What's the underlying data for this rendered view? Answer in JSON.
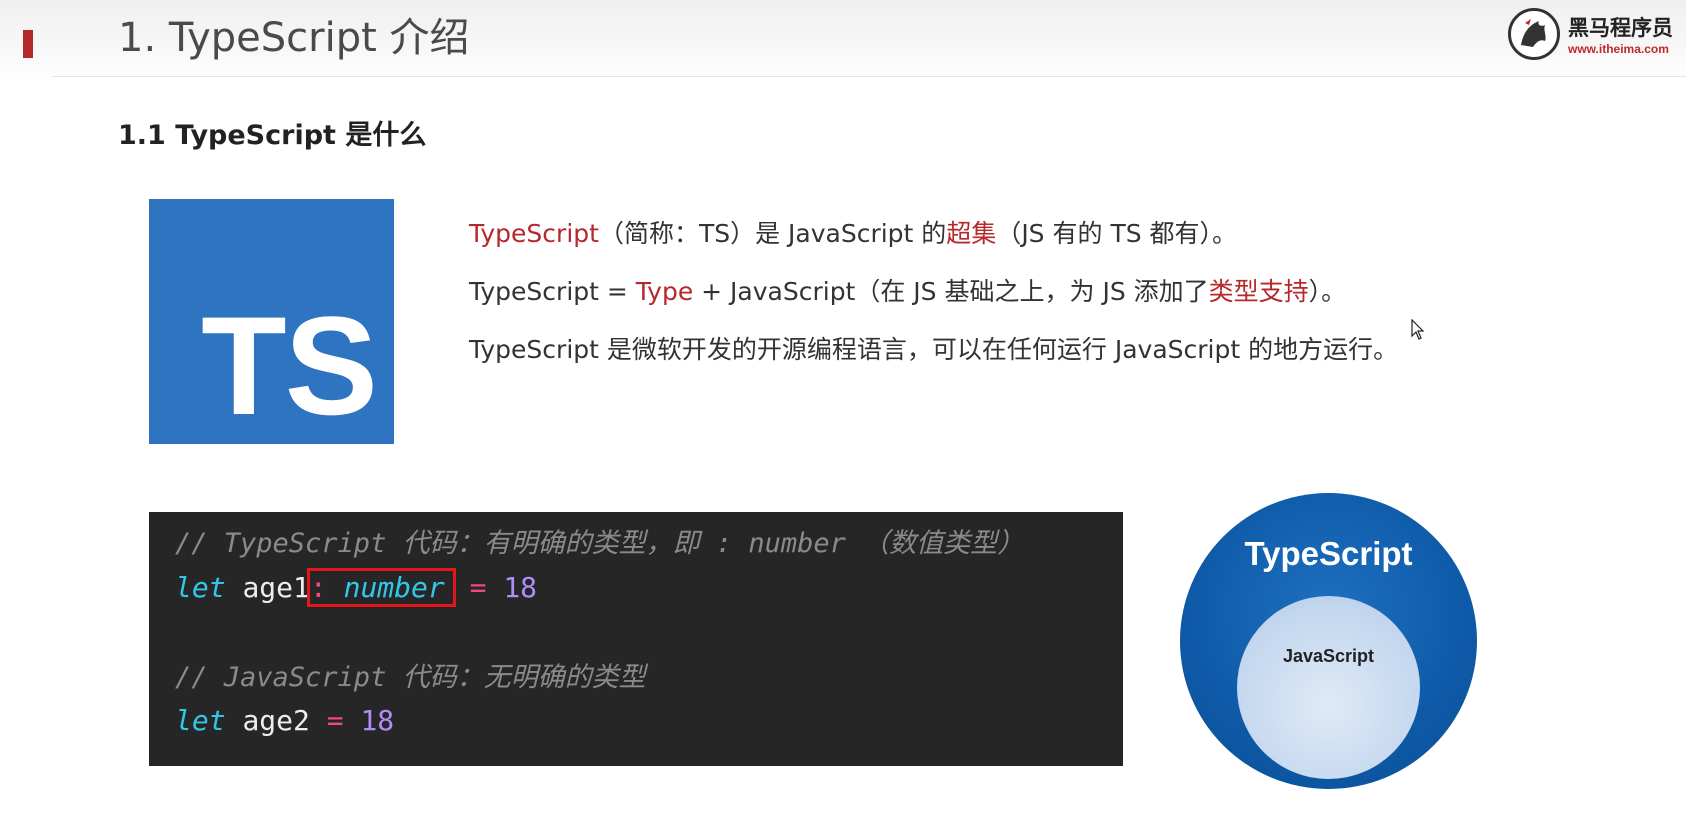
{
  "header": {
    "title": "1. TypeScript 介绍",
    "logo_name": "黑马程序员",
    "logo_url": "www.itheima.com"
  },
  "section": {
    "heading": "1.1 TypeScript 是什么"
  },
  "ts_logo": {
    "text": "TS"
  },
  "description": {
    "line1": {
      "typescript": "TypeScript",
      "part1": "（简称：TS）是 JavaScript 的",
      "superset": "超集",
      "part2": "（JS 有的 TS 都有）。"
    },
    "line2": {
      "part1": "TypeScript = ",
      "type": "Type",
      "part2": " + JavaScript（在 JS 基础之上，为 JS 添加了",
      "type_support": "类型支持",
      "part3": "）。"
    },
    "line3": "TypeScript 是微软开发的开源编程语言，可以在任何运行 JavaScript 的地方运行。"
  },
  "code": {
    "comment1": "// TypeScript 代码：有明确的类型，即 : number （数值类型）",
    "line1": {
      "keyword": "let",
      "name": "age1",
      "colon": ":",
      "type": "number",
      "op": "=",
      "value": "18"
    },
    "comment2": "// JavaScript 代码：无明确的类型",
    "line2": {
      "keyword": "let",
      "name": "age2",
      "op": "=",
      "value": "18"
    }
  },
  "diagram": {
    "outer_label": "TypeScript",
    "inner_label": "JavaScript"
  },
  "colors": {
    "accent_red": "#b5282c",
    "ts_blue": "#2f74c0",
    "code_bg": "#262626"
  }
}
